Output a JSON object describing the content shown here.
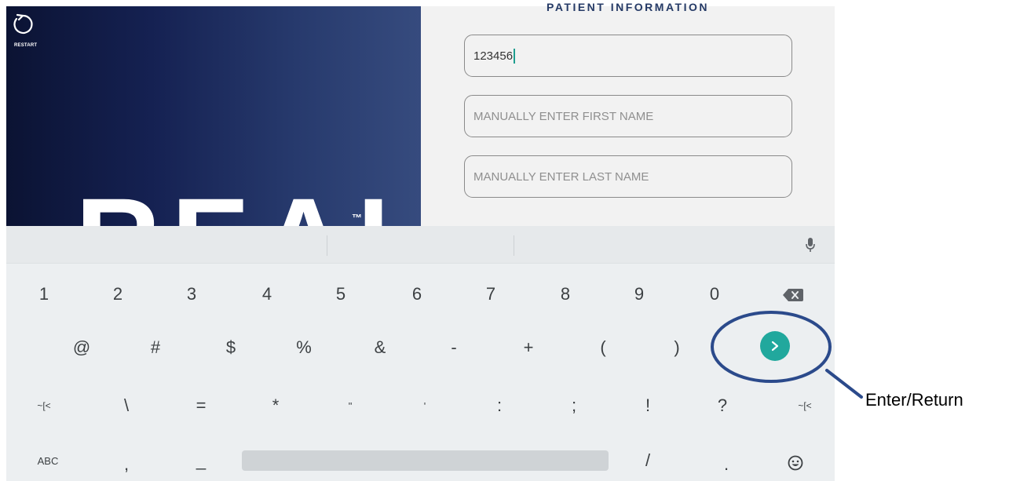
{
  "header": {
    "restart_label": "RESTART",
    "brand_partial": "REAL",
    "trademark": "TM",
    "section_title": "PATIENT INFORMATION"
  },
  "form": {
    "id_value": "123456",
    "first_name_placeholder": "MANUALLY ENTER FIRST NAME",
    "last_name_placeholder": "MANUALLY ENTER LAST NAME"
  },
  "keyboard": {
    "row1": [
      "1",
      "2",
      "3",
      "4",
      "5",
      "6",
      "7",
      "8",
      "9",
      "0"
    ],
    "row2": [
      "@",
      "#",
      "$",
      "%",
      "&",
      "-",
      "+",
      "(",
      ")"
    ],
    "row3": [
      "~[<",
      "\\",
      "=",
      "*",
      "\"",
      "'",
      ":",
      ";",
      "!",
      "?",
      "~[<"
    ],
    "row4": {
      "abc": "ABC",
      "comma": ",",
      "underscore": "_",
      "slash": "/",
      "period": "."
    },
    "icons": {
      "mic": "mic-icon",
      "backspace": "backspace-icon",
      "enter": "chevron-right-icon",
      "emoji": "emoji-icon"
    }
  },
  "annotation": {
    "label": "Enter/Return"
  },
  "colors": {
    "hero_dark": "#0b1333",
    "hero_light": "#364b7e",
    "accent": "#21a89d",
    "annotation_ring": "#2b4a8b",
    "title": "#253a66"
  }
}
